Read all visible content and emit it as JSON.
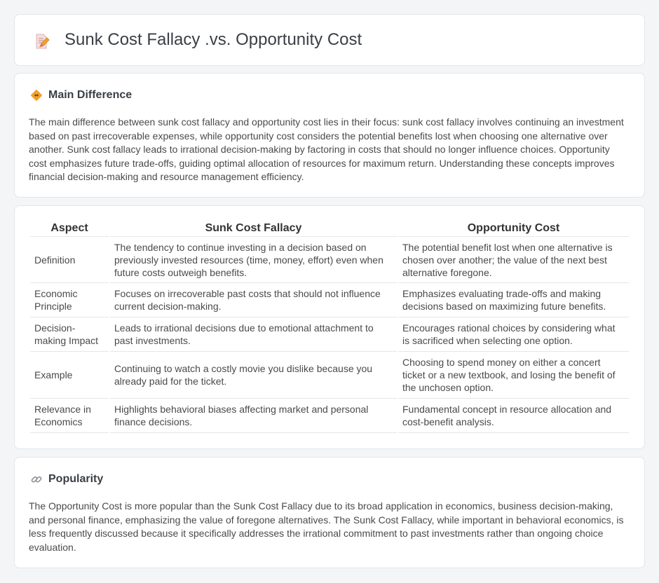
{
  "page": {
    "title": "Sunk Cost Fallacy .vs. Opportunity Cost",
    "title_icon": "document-pencil-icon"
  },
  "main_difference": {
    "heading": "Main Difference",
    "icon": "diamond-arrows-icon",
    "text": "The main difference between sunk cost fallacy and opportunity cost lies in their focus: sunk cost fallacy involves continuing an investment based on past irrecoverable expenses, while opportunity cost considers the potential benefits lost when choosing one alternative over another. Sunk cost fallacy leads to irrational decision-making by factoring in costs that should no longer influence choices. Opportunity cost emphasizes future trade-offs, guiding optimal allocation of resources for maximum return. Understanding these concepts improves financial decision-making and resource management efficiency."
  },
  "comparison": {
    "headers": [
      "Aspect",
      "Sunk Cost Fallacy",
      "Opportunity Cost"
    ],
    "rows": [
      {
        "aspect": "Definition",
        "sunk": "The tendency to continue investing in a decision based on previously invested resources (time, money, effort) even when future costs outweigh benefits.",
        "opp": "The potential benefit lost when one alternative is chosen over another; the value of the next best alternative foregone."
      },
      {
        "aspect": "Economic Principle",
        "sunk": "Focuses on irrecoverable past costs that should not influence current decision-making.",
        "opp": "Emphasizes evaluating trade-offs and making decisions based on maximizing future benefits."
      },
      {
        "aspect": "Decision-making Impact",
        "sunk": "Leads to irrational decisions due to emotional attachment to past investments.",
        "opp": "Encourages rational choices by considering what is sacrificed when selecting one option."
      },
      {
        "aspect": "Example",
        "sunk": "Continuing to watch a costly movie you dislike because you already paid for the ticket.",
        "opp": "Choosing to spend money on either a concert ticket or a new textbook, and losing the benefit of the unchosen option."
      },
      {
        "aspect": "Relevance in Economics",
        "sunk": "Highlights behavioral biases affecting market and personal finance decisions.",
        "opp": "Fundamental concept in resource allocation and cost-benefit analysis."
      }
    ]
  },
  "popularity": {
    "heading": "Popularity",
    "icon": "link-icon",
    "text": "The Opportunity Cost is more popular than the Sunk Cost Fallacy due to its broad application in economics, business decision-making, and personal finance, emphasizing the value of foregone alternatives. The Sunk Cost Fallacy, while important in behavioral economics, is less frequently discussed because it specifically addresses the irrational commitment to past investments rather than ongoing choice evaluation."
  },
  "colors": {
    "background": "#f4f5f7",
    "card": "#ffffff",
    "accent_orange": "#f0a030",
    "icon_pink": "#e46a6a"
  }
}
